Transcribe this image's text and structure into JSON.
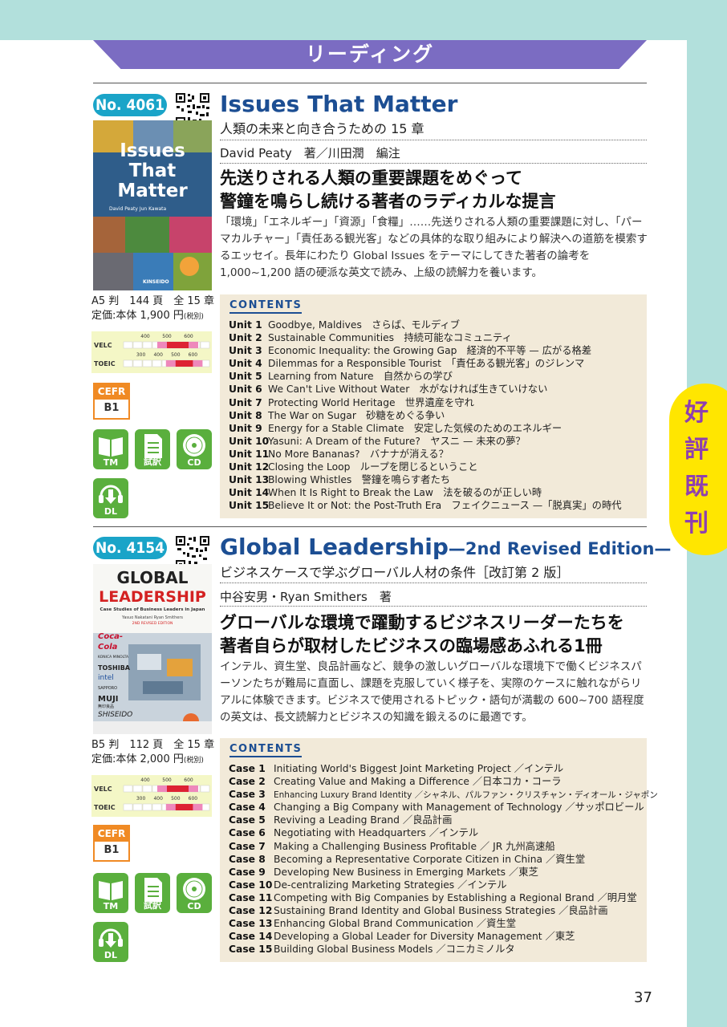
{
  "section_title": "リーディング",
  "side_tab": [
    "好",
    "評",
    "既",
    "刊"
  ],
  "page_number": "37",
  "chart_labels": {
    "velc": "VELC",
    "toeic": "TOEIC",
    "velc_ticks": [
      "400",
      "500",
      "600"
    ],
    "toeic_ticks": [
      "300",
      "400",
      "500",
      "600"
    ]
  },
  "colors": {
    "banner": "#7b6cc2",
    "title_blue": "#1c4e93",
    "badge_blue": "#1aa4c8",
    "media_green": "#5aaf3d",
    "cefr_orange": "#f08a24",
    "side_yellow": "#ffe600",
    "side_purple": "#8e3fb0",
    "teal": "#b2e0dc",
    "contents_bg": "#f2ead9"
  },
  "books": [
    {
      "number": "No. 4061",
      "title": "Issues That Matter",
      "edition": "",
      "subtitle": "人類の未来と向き合うための 15 章",
      "author": "David Peaty　著／川田潤　編注",
      "headline": [
        "先送りされる人類の重要課題をめぐって",
        "警鐘を鳴らし続ける著者のラディカルな提言"
      ],
      "description": "「環境」「エネルギー」「資源」「食糧」……先送りされる人類の重要課題に対し、「パーマカルチャー」「責任ある観光客」などの具体的な取り組みにより解決への道筋を模索するエッセイ。長年にわたり Global Issues をテーマにしてきた著者の論考を 1,000~1,200 語の硬派な英文で読み、上級の読解力を養います。",
      "cover": {
        "line1": "Issues",
        "line2": "That",
        "line3": "Matter",
        "authors": "David Peaty  Jun Kawata",
        "publisher": "KINSEIDO"
      },
      "format": "A5 判　144 頁　全 15 章",
      "price": "定価:本体 1,900 円",
      "tax": "(税別)",
      "cefr_label": "CEFR",
      "cefr_level": "B1",
      "velc_range": [
        500,
        600
      ],
      "toeic_range": [
        500,
        600
      ],
      "media": [
        "TM",
        "試訳",
        "CD",
        "DL"
      ],
      "contents_label": "CONTENTS",
      "contents": [
        {
          "num": "Unit 1",
          "text": "Goodbye, Maldives　さらば、モルディブ"
        },
        {
          "num": "Unit 2",
          "text": "Sustainable Communities　持続可能なコミュニティ"
        },
        {
          "num": "Unit 3",
          "text": "Economic Inequality: the Growing Gap　経済的不平等 — 広がる格差"
        },
        {
          "num": "Unit 4",
          "text": "Dilemmas for a Responsible Tourist　「責任ある観光客」のジレンマ"
        },
        {
          "num": "Unit 5",
          "text": "Learning from Nature　自然からの学び"
        },
        {
          "num": "Unit 6",
          "text": "We Can't Live Without Water　水がなければ生きていけない"
        },
        {
          "num": "Unit 7",
          "text": "Protecting World Heritage　世界遺産を守れ"
        },
        {
          "num": "Unit 8",
          "text": "The War on Sugar　砂糖をめぐる争い"
        },
        {
          "num": "Unit 9",
          "text": "Energy for a Stable Climate　安定した気候のためのエネルギー"
        },
        {
          "num": "Unit 10",
          "text": "Yasuni: A Dream of the Future?　ヤスニ — 未来の夢？"
        },
        {
          "num": "Unit 11",
          "text": "No More Bananas?　バナナが消える？"
        },
        {
          "num": "Unit 12",
          "text": "Closing the Loop　ループを閉じるということ"
        },
        {
          "num": "Unit 13",
          "text": "Blowing Whistles　警鐘を鳴らす者たち"
        },
        {
          "num": "Unit 14",
          "text": "When It Is Right to Break the Law　法を破るのが正しい時"
        },
        {
          "num": "Unit 15",
          "text": "Believe It or Not: the Post-Truth Era　フェイクニュース —「脱真実」の時代"
        }
      ]
    },
    {
      "number": "No. 4154",
      "title": "Global Leadership",
      "edition": "—2nd Revised Edition—",
      "subtitle": "ビジネスケースで学ぶグローバル人材の条件［改訂第 2 版］",
      "author": "中谷安男・Ryan Smithers　著",
      "headline": [
        "グローバルな環境で躍動するビジネスリーダーたちを",
        "著者自らが取材したビジネスの臨場感あふれる1冊"
      ],
      "description": "インテル、資生堂、良品計画など、競争の激しいグローバルな環境下で働くビジネスパーソンたちが難局に直面し、課題を克服していく様子を、実際のケースに触れながらリアルに体験できます。ビジネスで使用されるトピック・語句が満載の 600~700 語程度の英文は、長文読解力とビジネスの知識を鍛えるのに最適です。",
      "cover": {
        "line1": "GLOBAL",
        "line2": "LEADERSHIP",
        "line3": "Case Studies of Business Leaders in Japan",
        "authors": "Yasuo Nakatani  Ryan Smithers",
        "publisher": "2ND REVISED EDITION",
        "logos": [
          "Coca-Cola",
          "KONICA MINOLTA",
          "TOSHIBA",
          "intel",
          "SAPPORO",
          "MUJI",
          "無印良品",
          "SHISEIDO"
        ]
      },
      "format": "B5 判　112 頁　全 15 章",
      "price": "定価:本体 2,000 円",
      "tax": "(税別)",
      "cefr_label": "CEFR",
      "cefr_level": "B1",
      "velc_range": [
        500,
        600
      ],
      "toeic_range": [
        500,
        600
      ],
      "media": [
        "TM",
        "試訳",
        "CD",
        "DL"
      ],
      "contents_label": "CONTENTS",
      "contents": [
        {
          "num": "Case 1",
          "text": "Initiating World's Biggest Joint Marketing Project ／インテル"
        },
        {
          "num": "Case 2",
          "text": "Creating Value and Making a Difference ／日本コカ・コーラ"
        },
        {
          "num": "Case 3",
          "text": "Enhancing Luxury Brand Identity ／シャネル、パルファン・クリスチャン・ディオール・ジャポン"
        },
        {
          "num": "Case 4",
          "text": "Changing a Big Company with Management of Technology ／サッポロビール"
        },
        {
          "num": "Case 5",
          "text": "Reviving a Leading Brand ／良品計画"
        },
        {
          "num": "Case 6",
          "text": "Negotiating with Headquarters ／インテル"
        },
        {
          "num": "Case 7",
          "text": "Making a Challenging Business Profitable ／ JR 九州高速船"
        },
        {
          "num": "Case 8",
          "text": "Becoming a Representative Corporate Citizen in China ／資生堂"
        },
        {
          "num": "Case 9",
          "text": "Developing New Business in Emerging Markets ／東芝"
        },
        {
          "num": "Case 10",
          "text": "De-centralizing Marketing Strategies ／インテル"
        },
        {
          "num": "Case 11",
          "text": "Competing with Big Companies by Establishing a Regional Brand ／明月堂"
        },
        {
          "num": "Case 12",
          "text": "Sustaining Brand Identity and Global Business Strategies ／良品計画"
        },
        {
          "num": "Case 13",
          "text": "Enhancing Global Brand Communication ／資生堂"
        },
        {
          "num": "Case 14",
          "text": "Developing a Global Leader for Diversity Management ／東芝"
        },
        {
          "num": "Case 15",
          "text": "Building Global Business Models ／コニカミノルタ"
        }
      ]
    }
  ]
}
